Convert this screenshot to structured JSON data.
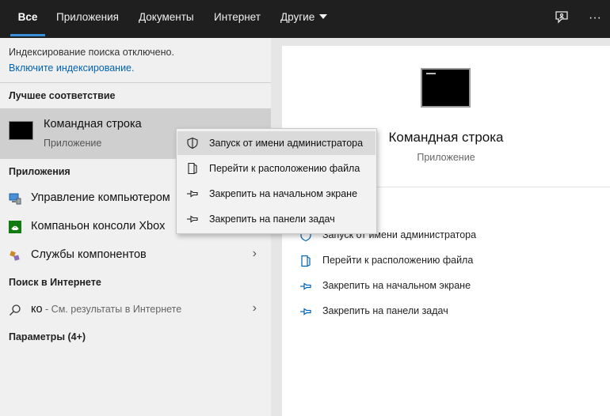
{
  "tabs": [
    {
      "label": "Все",
      "active": true
    },
    {
      "label": "Приложения"
    },
    {
      "label": "Документы"
    },
    {
      "label": "Интернет"
    },
    {
      "label": "Другие"
    }
  ],
  "top_icons": [
    "feedback-icon",
    "more-options-icon"
  ],
  "more_glyph": "···",
  "notice": {
    "text": "Индексирование поиска отключено.",
    "link": "Включите индексирование."
  },
  "best_match": {
    "section": "Лучшее соответствие",
    "title": "Командная строка",
    "subtitle": "Приложение"
  },
  "apps": {
    "section": "Приложения",
    "items": [
      {
        "label": "Управление компьютером",
        "icon": "computer-management-icon"
      },
      {
        "label": "Компаньон консоли Xbox",
        "icon": "xbox-icon"
      },
      {
        "label": "Службы компонентов",
        "icon": "component-services-icon"
      }
    ]
  },
  "web": {
    "section": "Поиск в Интернете",
    "query": "ко",
    "suffix": " - См. результаты в Интернете"
  },
  "settings_section": "Параметры (4+)",
  "detail": {
    "title": "Командная строка",
    "subtitle": "Приложение",
    "actions": [
      {
        "label": "Запуск от имени администратора",
        "icon": "shield-icon"
      },
      {
        "label": "Перейти к расположению файла",
        "icon": "file-location-icon"
      },
      {
        "label": "Закрепить на начальном экране",
        "icon": "pin-icon"
      },
      {
        "label": "Закрепить на панели задач",
        "icon": "pin-icon"
      }
    ]
  },
  "context_menu": {
    "items": [
      {
        "label": "Запуск от имени администратора",
        "icon": "shield-icon",
        "highlighted": true
      },
      {
        "label": "Перейти к расположению файла",
        "icon": "file-location-icon"
      },
      {
        "label": "Закрепить на начальном экране",
        "icon": "pin-icon"
      },
      {
        "label": "Закрепить на панели задач",
        "icon": "pin-icon"
      }
    ]
  },
  "colors": {
    "accent": "#0063b1",
    "tab_underline": "#3a8fd9",
    "topbar": "#1f1f1f"
  }
}
